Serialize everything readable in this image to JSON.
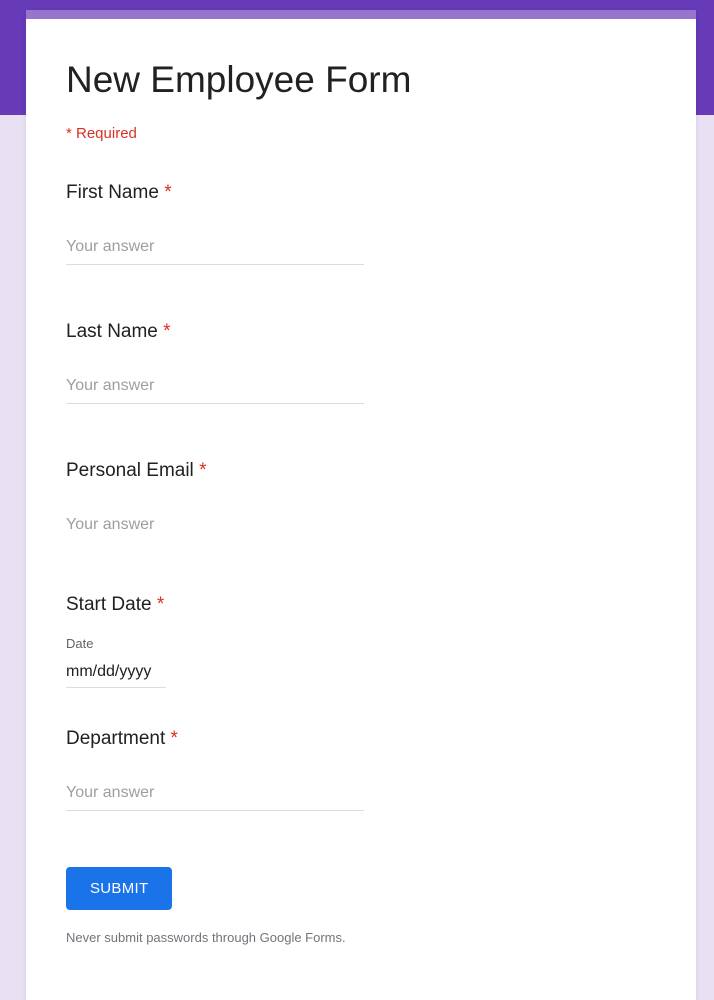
{
  "form": {
    "title": "New Employee Form",
    "required_note": "* Required",
    "fields": {
      "first_name": {
        "label": "First Name ",
        "placeholder": "Your answer"
      },
      "last_name": {
        "label": "Last Name ",
        "placeholder": "Your answer"
      },
      "personal_email": {
        "label": "Personal Email ",
        "placeholder": "Your answer"
      },
      "start_date": {
        "label": "Start Date ",
        "sublabel": "Date",
        "value": "mm/dd/yyyy"
      },
      "department": {
        "label": "Department ",
        "placeholder": "Your answer"
      }
    },
    "asterisk": "*",
    "submit_label": "SUBMIT",
    "disclaimer": "Never submit passwords through Google Forms."
  }
}
